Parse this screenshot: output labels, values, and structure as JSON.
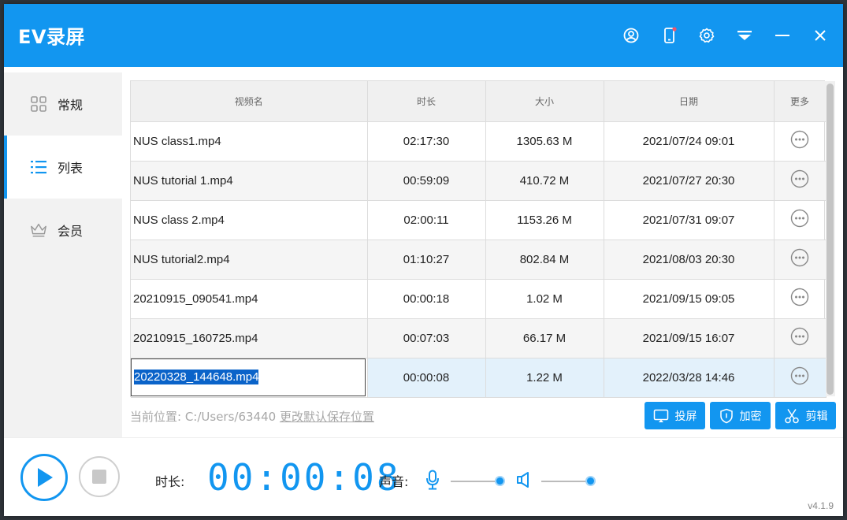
{
  "app": {
    "title": "EV录屏",
    "version": "v4.1.9",
    "accent_color": "#1296f0"
  },
  "titlebar_icons": [
    "user-icon",
    "mobile-icon",
    "settings-gear-icon",
    "dropdown-menu-icon",
    "minimize-icon",
    "close-icon"
  ],
  "sidebar": {
    "items": [
      {
        "label": "常规",
        "icon": "grid-icon",
        "active": false
      },
      {
        "label": "列表",
        "icon": "list-icon",
        "active": true
      },
      {
        "label": "会员",
        "icon": "crown-icon",
        "active": false
      }
    ]
  },
  "table": {
    "headers": [
      "视频名",
      "时长",
      "大小",
      "日期",
      "更多"
    ],
    "rows": [
      {
        "name": "NUS class1.mp4",
        "duration": "02:17:30",
        "size": "1305.63 M",
        "date": "2021/07/24 09:01"
      },
      {
        "name": "NUS tutorial 1.mp4",
        "duration": "00:59:09",
        "size": "410.72 M",
        "date": "2021/07/27 20:30"
      },
      {
        "name": "NUS class 2.mp4",
        "duration": "02:00:11",
        "size": "1153.26 M",
        "date": "2021/07/31 09:07"
      },
      {
        "name": "NUS tutorial2.mp4",
        "duration": "01:10:27",
        "size": "802.84 M",
        "date": "2021/08/03 20:30"
      },
      {
        "name": "20210915_090541.mp4",
        "duration": "00:00:18",
        "size": "1.02 M",
        "date": "2021/09/15 09:05"
      },
      {
        "name": "20210915_160725.mp4",
        "duration": "00:07:03",
        "size": "66.17 M",
        "date": "2021/09/15 16:07"
      },
      {
        "name": "20220328_144648.mp4",
        "duration": "00:00:08",
        "size": "1.22 M",
        "date": "2022/03/28 14:46"
      }
    ],
    "selected_row": 6
  },
  "footer": {
    "path_label": "当前位置: C:/Users/63440",
    "change_path_link": "更改默认保存位置",
    "buttons": [
      {
        "label": "投屏",
        "icon": "cast-icon"
      },
      {
        "label": "加密",
        "icon": "shield-icon"
      },
      {
        "label": "剪辑",
        "icon": "scissors-icon"
      }
    ]
  },
  "controls": {
    "duration_label": "时长:",
    "timer": "00:00:08",
    "sound_label": "声音:",
    "mic_volume": 1.0,
    "speaker_volume": 1.0
  }
}
